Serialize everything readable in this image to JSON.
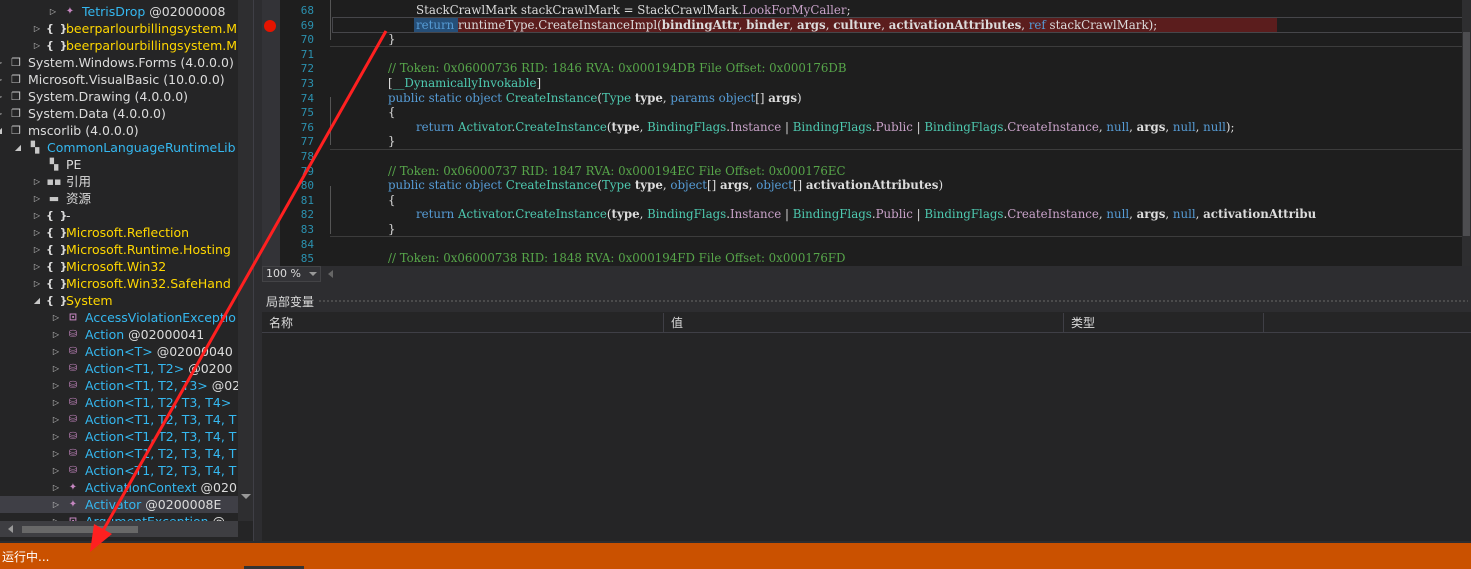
{
  "tree": {
    "rows": [
      {
        "label": "TetrisDrop",
        "suffix": " @02000008",
        "cls": "c-type",
        "icon": "class-icon",
        "glyph": "✦",
        "tw": "▷",
        "indent": 62
      },
      {
        "label": "beerparlourbillingsystem.M",
        "suffix": "",
        "cls": "c-ns",
        "icon": "namespace-icon",
        "glyph": "{ }",
        "tw": "▷",
        "indent": 46
      },
      {
        "label": "beerparlourbillingsystem.M",
        "suffix": "",
        "cls": "c-ns",
        "icon": "namespace-icon",
        "glyph": "{ }",
        "tw": "▷",
        "indent": 46
      },
      {
        "label": "System.Windows.Forms (4.0.0.0)",
        "suffix": "",
        "cls": "c-asm",
        "icon": "assembly-icon",
        "glyph": "❐",
        "tw": "▷",
        "indent": 8
      },
      {
        "label": "Microsoft.VisualBasic (10.0.0.0)",
        "suffix": "",
        "cls": "c-asm",
        "icon": "assembly-icon",
        "glyph": "❐",
        "tw": "▷",
        "indent": 8
      },
      {
        "label": "System.Drawing (4.0.0.0)",
        "suffix": "",
        "cls": "c-asm",
        "icon": "assembly-icon",
        "glyph": "❐",
        "tw": "▷",
        "indent": 8
      },
      {
        "label": "System.Data (4.0.0.0)",
        "suffix": "",
        "cls": "c-asm",
        "icon": "assembly-icon",
        "glyph": "❐",
        "tw": "▷",
        "indent": 8
      },
      {
        "label": "mscorlib (4.0.0.0)",
        "suffix": "",
        "cls": "c-asm",
        "icon": "assembly-icon",
        "glyph": "❐",
        "tw": "◢",
        "indent": 8
      },
      {
        "label": "CommonLanguageRuntimeLib",
        "suffix": "",
        "cls": "c-type",
        "icon": "module-icon",
        "glyph": "▚",
        "tw": "◢",
        "indent": 27
      },
      {
        "label": "PE",
        "suffix": "",
        "cls": "c-pe",
        "icon": "pe-icon",
        "glyph": "▚",
        "tw": "",
        "indent": 46
      },
      {
        "label": "引用",
        "suffix": "",
        "cls": "c-pe",
        "icon": "references-icon",
        "glyph": "▪▪",
        "tw": "▷",
        "indent": 46
      },
      {
        "label": "资源",
        "suffix": "",
        "cls": "c-pe",
        "icon": "folder-icon",
        "glyph": "▬",
        "tw": "▷",
        "indent": 46
      },
      {
        "label": "-",
        "suffix": "",
        "cls": "c-pe",
        "icon": "namespace-icon",
        "glyph": "{ }",
        "tw": "▷",
        "indent": 46
      },
      {
        "label": "Microsoft.Reflection",
        "suffix": "",
        "cls": "c-ns",
        "icon": "namespace-icon",
        "glyph": "{ }",
        "tw": "▷",
        "indent": 46
      },
      {
        "label": "Microsoft.Runtime.Hosting",
        "suffix": "",
        "cls": "c-ns",
        "icon": "namespace-icon",
        "glyph": "{ }",
        "tw": "▷",
        "indent": 46
      },
      {
        "label": "Microsoft.Win32",
        "suffix": "",
        "cls": "c-ns",
        "icon": "namespace-icon",
        "glyph": "{ }",
        "tw": "▷",
        "indent": 46
      },
      {
        "label": "Microsoft.Win32.SafeHand",
        "suffix": "",
        "cls": "c-ns",
        "icon": "namespace-icon",
        "glyph": "{ }",
        "tw": "▷",
        "indent": 46
      },
      {
        "label": "System",
        "suffix": "",
        "cls": "c-ns",
        "icon": "namespace-icon",
        "glyph": "{ }",
        "tw": "◢",
        "indent": 46
      },
      {
        "label": "AccessViolationExceptio",
        "suffix": "",
        "cls": "c-type",
        "icon": "exception-class-icon",
        "glyph": "⊡",
        "tw": "▷",
        "indent": 65
      },
      {
        "label": "Action",
        "suffix": " @02000041",
        "cls": "c-type",
        "icon": "delegate-icon",
        "glyph": "⛁",
        "tw": "▷",
        "indent": 65
      },
      {
        "label": "Action<T>",
        "suffix": " @02000040",
        "cls": "c-type",
        "icon": "delegate-icon",
        "glyph": "⛁",
        "tw": "▷",
        "indent": 65
      },
      {
        "label": "Action<T1, T2>",
        "suffix": " @0200",
        "cls": "c-type",
        "icon": "delegate-icon",
        "glyph": "⛁",
        "tw": "▷",
        "indent": 65
      },
      {
        "label": "Action<T1, T2, T3>",
        "suffix": " @02",
        "cls": "c-type",
        "icon": "delegate-icon",
        "glyph": "⛁",
        "tw": "▷",
        "indent": 65
      },
      {
        "label": "Action<T1, T2, T3, T4>",
        "suffix": "",
        "cls": "c-type",
        "icon": "delegate-icon",
        "glyph": "⛁",
        "tw": "▷",
        "indent": 65
      },
      {
        "label": "Action<T1, T2, T3, T4, T",
        "suffix": "",
        "cls": "c-type",
        "icon": "delegate-icon",
        "glyph": "⛁",
        "tw": "▷",
        "indent": 65
      },
      {
        "label": "Action<T1, T2, T3, T4, T",
        "suffix": "",
        "cls": "c-type",
        "icon": "delegate-icon",
        "glyph": "⛁",
        "tw": "▷",
        "indent": 65
      },
      {
        "label": "Action<T1, T2, T3, T4, T",
        "suffix": "",
        "cls": "c-type",
        "icon": "delegate-icon",
        "glyph": "⛁",
        "tw": "▷",
        "indent": 65
      },
      {
        "label": "Action<T1, T2, T3, T4, T",
        "suffix": "",
        "cls": "c-type",
        "icon": "delegate-icon",
        "glyph": "⛁",
        "tw": "▷",
        "indent": 65
      },
      {
        "label": "ActivationContext",
        "suffix": " @020",
        "cls": "c-type",
        "icon": "class-icon",
        "glyph": "✦",
        "tw": "▷",
        "indent": 65
      },
      {
        "label": "Activator",
        "suffix": " @0200008E",
        "cls": "c-type",
        "icon": "class-icon",
        "glyph": "✦",
        "tw": "▷",
        "indent": 65,
        "selected": true
      },
      {
        "label": "ArgumentException",
        "suffix": " @",
        "cls": "c-type",
        "icon": "exception-class-icon",
        "glyph": "⊡",
        "tw": "▷",
        "indent": 65
      }
    ]
  },
  "editor": {
    "lines": [
      {
        "n": "68",
        "html": "StackCrawlMark stackCrawlMark = StackCrawlMark.<span class='fd'>LookForMyCaller</span>;",
        "indent": 1
      },
      {
        "n": "69",
        "html": "<span class='kw'>return</span> runtimeType.CreateInstanceImpl(<span class='bd'>bindingAttr</span>, <span class='bd'>binder</span>, <span class='bd'>args</span>, <span class='bd'>culture</span>, <span class='bd'>activationAttributes</span>, <span class='kw'>ref</span> stackCrawlMark);",
        "indent": 1
      },
      {
        "n": "70",
        "html": "}",
        "indent": 0
      },
      {
        "n": "71",
        "html": "",
        "indent": 0
      },
      {
        "n": "72",
        "html": "<span class='cm'>// Token: 0x06000736 RID: 1846 RVA: 0x000194DB File Offset: 0x000176DB</span>",
        "indent": 0
      },
      {
        "n": "73",
        "html": "[<span class='ty'>__DynamicallyInvokable</span>]",
        "indent": 0
      },
      {
        "n": "74",
        "html": "<span class='kw'>public static object</span> <span class='ty'>CreateInstance</span>(<span class='ty'>Type</span> <span class='bd'>type</span>, <span class='kw'>params object</span>[] <span class='bd'>args</span>)",
        "indent": 0
      },
      {
        "n": "75",
        "html": "{",
        "indent": 0
      },
      {
        "n": "76",
        "html": "<span class='kw'>return</span> <span class='ty'>Activator</span>.<span class='ty'>CreateInstance</span>(<span class='bd'>type</span>, <span class='ty'>BindingFlags</span>.<span class='fd'>Instance</span> | <span class='ty'>BindingFlags</span>.<span class='fd'>Public</span> | <span class='ty'>BindingFlags</span>.<span class='fd'>CreateInstance</span>, <span class='nl'>null</span>, <span class='bd'>args</span>, <span class='nl'>null</span>, <span class='nl'>null</span>);",
        "indent": 1
      },
      {
        "n": "77",
        "html": "}",
        "indent": 0
      },
      {
        "n": "78",
        "html": "",
        "indent": 0
      },
      {
        "n": "79",
        "html": "<span class='cm'>// Token: 0x06000737 RID: 1847 RVA: 0x000194EC File Offset: 0x000176EC</span>",
        "indent": 0
      },
      {
        "n": "80",
        "html": "<span class='kw'>public static object</span> <span class='ty'>CreateInstance</span>(<span class='ty'>Type</span> <span class='bd'>type</span>, <span class='kw'>object</span>[] <span class='bd'>args</span>, <span class='kw'>object</span>[] <span class='bd'>activationAttributes</span>)",
        "indent": 0
      },
      {
        "n": "81",
        "html": "{",
        "indent": 0
      },
      {
        "n": "82",
        "html": "<span class='kw'>return</span> <span class='ty'>Activator</span>.<span class='ty'>CreateInstance</span>(<span class='bd'>type</span>, <span class='ty'>BindingFlags</span>.<span class='fd'>Instance</span> | <span class='ty'>BindingFlags</span>.<span class='fd'>Public</span> | <span class='ty'>BindingFlags</span>.<span class='fd'>CreateInstance</span>, <span class='nl'>null</span>, <span class='bd'>args</span>, <span class='nl'>null</span>, <span class='bd'>activationAttribu</span>",
        "indent": 1
      },
      {
        "n": "83",
        "html": "}",
        "indent": 0
      },
      {
        "n": "84",
        "html": "",
        "indent": 0
      },
      {
        "n": "85",
        "html": "<span class='cm'>// Token: 0x06000738 RID: 1848 RVA: 0x000194FD File Offset: 0x000176FD</span>",
        "indent": 0
      }
    ],
    "zoom": "100 %",
    "breakpoint_line": "69"
  },
  "locals": {
    "title": "局部变量",
    "columns": [
      "名称",
      "值",
      "类型"
    ]
  },
  "status": {
    "text": "运行中..."
  },
  "colors": {
    "status_bar": "#ca5100",
    "breakpoint": "#e51400",
    "annotation_arrow": "#ff2020"
  }
}
